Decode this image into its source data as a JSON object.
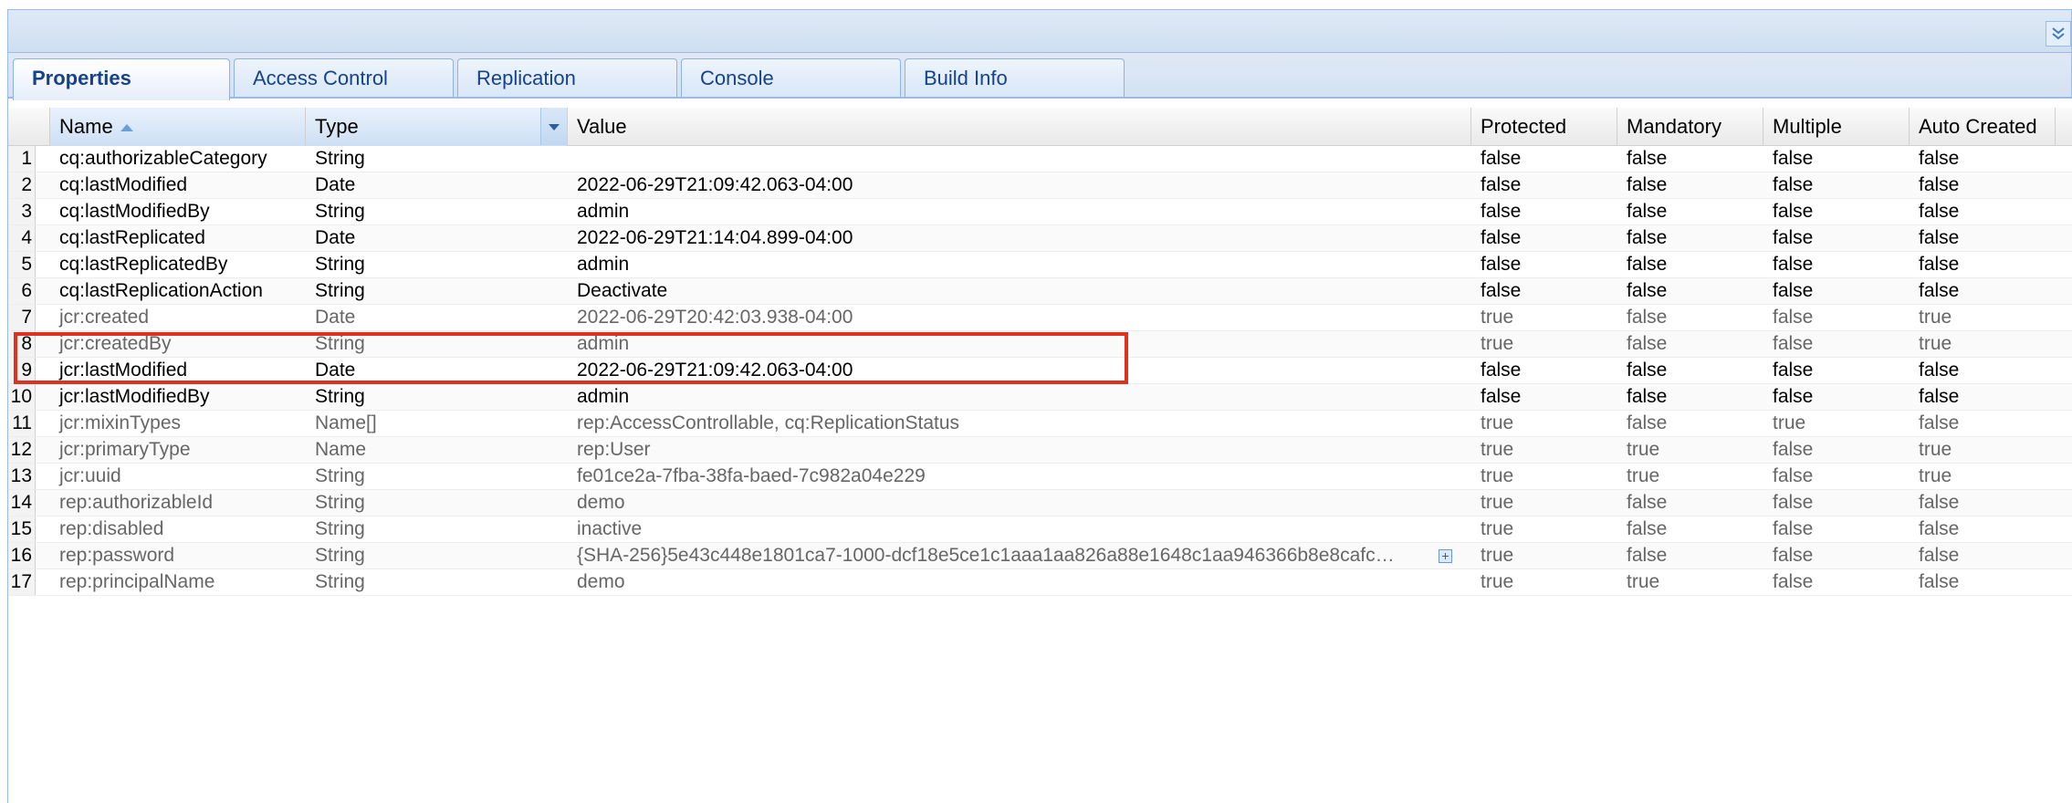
{
  "tabs": [
    {
      "label": "Properties",
      "active": true
    },
    {
      "label": "Access Control",
      "active": false
    },
    {
      "label": "Replication",
      "active": false
    },
    {
      "label": "Console",
      "active": false
    },
    {
      "label": "Build Info",
      "active": false
    }
  ],
  "columns": {
    "name": "Name",
    "type": "Type",
    "value": "Value",
    "protected": "Protected",
    "mandatory": "Mandatory",
    "multiple": "Multiple",
    "auto_created": "Auto Created"
  },
  "sort": {
    "column": "Name",
    "direction": "ascending"
  },
  "highlight": {
    "row_index": 6,
    "color": "#e0301e"
  },
  "rows": [
    {
      "num": "1",
      "name": "cq:authorizableCategory",
      "type": "String",
      "value": "",
      "protected": "false",
      "mandatory": "false",
      "multiple": "false",
      "auto_created": "false"
    },
    {
      "num": "2",
      "name": "cq:lastModified",
      "type": "Date",
      "value": "2022-06-29T21:09:42.063-04:00",
      "protected": "false",
      "mandatory": "false",
      "multiple": "false",
      "auto_created": "false"
    },
    {
      "num": "3",
      "name": "cq:lastModifiedBy",
      "type": "String",
      "value": "admin",
      "protected": "false",
      "mandatory": "false",
      "multiple": "false",
      "auto_created": "false"
    },
    {
      "num": "4",
      "name": "cq:lastReplicated",
      "type": "Date",
      "value": "2022-06-29T21:14:04.899-04:00",
      "protected": "false",
      "mandatory": "false",
      "multiple": "false",
      "auto_created": "false"
    },
    {
      "num": "5",
      "name": "cq:lastReplicatedBy",
      "type": "String",
      "value": "admin",
      "protected": "false",
      "mandatory": "false",
      "multiple": "false",
      "auto_created": "false"
    },
    {
      "num": "6",
      "name": "cq:lastReplicationAction",
      "type": "String",
      "value": "Deactivate",
      "protected": "false",
      "mandatory": "false",
      "multiple": "false",
      "auto_created": "false"
    },
    {
      "num": "7",
      "name": "jcr:created",
      "type": "Date",
      "value": "2022-06-29T20:42:03.938-04:00",
      "protected": "true",
      "mandatory": "false",
      "multiple": "false",
      "auto_created": "true"
    },
    {
      "num": "8",
      "name": "jcr:createdBy",
      "type": "String",
      "value": "admin",
      "protected": "true",
      "mandatory": "false",
      "multiple": "false",
      "auto_created": "true"
    },
    {
      "num": "9",
      "name": "jcr:lastModified",
      "type": "Date",
      "value": "2022-06-29T21:09:42.063-04:00",
      "protected": "false",
      "mandatory": "false",
      "multiple": "false",
      "auto_created": "false"
    },
    {
      "num": "10",
      "name": "jcr:lastModifiedBy",
      "type": "String",
      "value": "admin",
      "protected": "false",
      "mandatory": "false",
      "multiple": "false",
      "auto_created": "false"
    },
    {
      "num": "11",
      "name": "jcr:mixinTypes",
      "type": "Name[]",
      "value": "rep:AccessControllable, cq:ReplicationStatus",
      "protected": "true",
      "mandatory": "false",
      "multiple": "true",
      "auto_created": "false"
    },
    {
      "num": "12",
      "name": "jcr:primaryType",
      "type": "Name",
      "value": "rep:User",
      "protected": "true",
      "mandatory": "true",
      "multiple": "false",
      "auto_created": "true"
    },
    {
      "num": "13",
      "name": "jcr:uuid",
      "type": "String",
      "value": "fe01ce2a-7fba-38fa-baed-7c982a04e229",
      "protected": "true",
      "mandatory": "true",
      "multiple": "false",
      "auto_created": "true"
    },
    {
      "num": "14",
      "name": "rep:authorizableId",
      "type": "String",
      "value": "demo",
      "protected": "true",
      "mandatory": "false",
      "multiple": "false",
      "auto_created": "false"
    },
    {
      "num": "15",
      "name": "rep:disabled",
      "type": "String",
      "value": "inactive",
      "protected": "true",
      "mandatory": "false",
      "multiple": "false",
      "auto_created": "false"
    },
    {
      "num": "16",
      "name": "rep:password",
      "type": "String",
      "value": "{SHA-256}5e43c448e1801ca7-1000-dcf18e5ce1c1aaa1aa826a88e1648c1aa946366b8e8cafc…",
      "protected": "true",
      "mandatory": "false",
      "multiple": "false",
      "auto_created": "false",
      "expandable": true
    },
    {
      "num": "17",
      "name": "rep:principalName",
      "type": "String",
      "value": "demo",
      "protected": "true",
      "mandatory": "true",
      "multiple": "false",
      "auto_created": "false"
    }
  ]
}
